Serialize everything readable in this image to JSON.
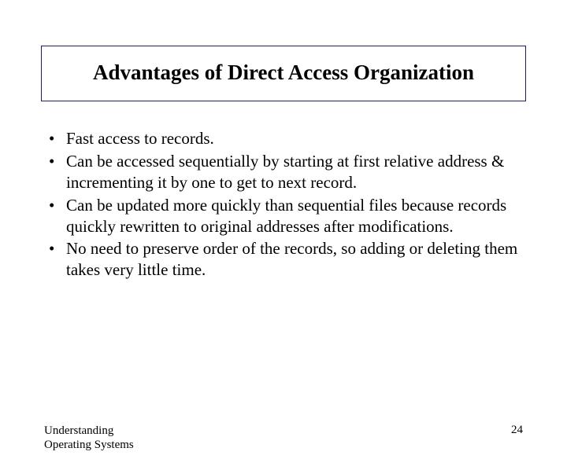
{
  "title": "Advantages of Direct Access Organization",
  "bullets": [
    "Fast access to records.",
    "Can be accessed sequentially by starting at first relative address & incrementing it by one to get to next record.",
    "Can be updated more quickly than sequential files because records quickly rewritten to original addresses after modifications.",
    "No need to preserve order of the records, so adding or deleting them takes very little time."
  ],
  "footer": {
    "left_line1": "Understanding",
    "left_line2": "Operating Systems",
    "page_number": "24"
  }
}
